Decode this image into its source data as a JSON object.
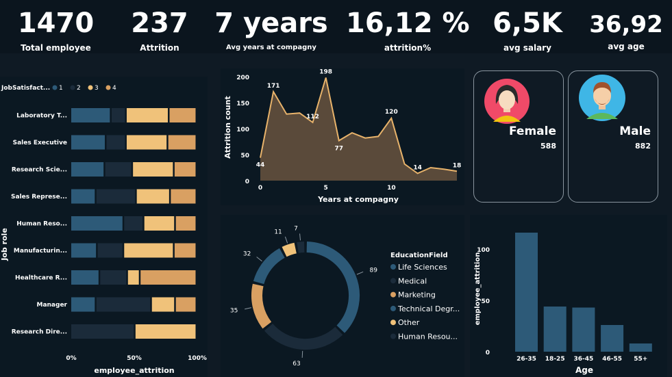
{
  "kpis": [
    {
      "value": "1470",
      "label": "Total employee"
    },
    {
      "value": "237",
      "label": "Attrition"
    },
    {
      "value": "7 years",
      "label": "Avg years at compagny"
    },
    {
      "value": "16,12 %",
      "label": "attrition%"
    },
    {
      "value": "6,5K",
      "label": "avg salary"
    },
    {
      "value": "36,92",
      "label": "avg age"
    }
  ],
  "job_chart": {
    "legend_title": "JobSatisfact...",
    "legend": [
      {
        "label": "1",
        "color": "#2d5a78"
      },
      {
        "label": "2",
        "color": "#1b2b3a"
      },
      {
        "label": "3",
        "color": "#f0c27a"
      },
      {
        "label": "4",
        "color": "#d9a062"
      }
    ],
    "y_title": "Job role",
    "x_title": "employee_attrition",
    "x_ticks": [
      "0%",
      "50%",
      "100%"
    ]
  },
  "attrition_years": {
    "y_title": "Attrition count",
    "x_title": "Years at compagny",
    "y_ticks": [
      "0",
      "50",
      "100",
      "150",
      "200"
    ],
    "x_ticks": [
      "0",
      "5",
      "10"
    ],
    "labels": [
      "44",
      "171",
      "112",
      "198",
      "77",
      "120",
      "14",
      "18"
    ]
  },
  "gender": {
    "female": {
      "label": "Female",
      "value": "588"
    },
    "male": {
      "label": "Male",
      "value": "882"
    }
  },
  "education": {
    "legend_title": "EducationField",
    "items": [
      {
        "label": "Life Sciences",
        "color": "#2d5a78"
      },
      {
        "label": "Medical",
        "color": "#1b2b3a"
      },
      {
        "label": "Marketing",
        "color": "#d9a062"
      },
      {
        "label": "Technical Degr...",
        "color": "#2d5a78"
      },
      {
        "label": "Other",
        "color": "#f0c27a"
      },
      {
        "label": "Human Resou...",
        "color": "#1b2b3a"
      }
    ]
  },
  "age_chart": {
    "y_title": "employee_attrition",
    "x_title": "Age",
    "y_ticks": [
      "0",
      "50",
      "100"
    ]
  },
  "chart_data": [
    {
      "type": "bar",
      "orientation": "horizontal-stacked-100",
      "categories": [
        "Laboratory T...",
        "Sales Executive",
        "Research Scie...",
        "Sales Represe...",
        "Human Reso...",
        "Manufacturin...",
        "Healthcare R...",
        "Manager",
        "Research Dire..."
      ],
      "series": [
        {
          "name": "1",
          "values": [
            32,
            28,
            27,
            20,
            42,
            21,
            23,
            20,
            0
          ]
        },
        {
          "name": "2",
          "values": [
            12,
            16,
            22,
            32,
            16,
            21,
            22,
            44,
            51
          ]
        },
        {
          "name": "3",
          "values": [
            34,
            33,
            33,
            27,
            25,
            40,
            10,
            19,
            49
          ]
        },
        {
          "name": "4",
          "values": [
            22,
            23,
            18,
            21,
            17,
            18,
            45,
            17,
            0
          ]
        }
      ],
      "xlabel": "employee_attrition",
      "ylabel": "Job role",
      "xlim": [
        0,
        100
      ]
    },
    {
      "type": "area",
      "x": [
        0,
        1,
        2,
        3,
        4,
        5,
        6,
        7,
        8,
        9,
        10,
        11,
        12,
        13,
        14,
        15
      ],
      "y": [
        44,
        171,
        128,
        130,
        112,
        198,
        77,
        92,
        82,
        85,
        120,
        32,
        14,
        25,
        22,
        18
      ],
      "xlabel": "Years at compagny",
      "ylabel": "Attrition count",
      "ylim": [
        0,
        200
      ],
      "data_labels": {
        "0": "44",
        "1": "171",
        "4": "112",
        "5": "198",
        "6": "77",
        "10": "120",
        "12": "14",
        "15": "18"
      }
    },
    {
      "type": "pie",
      "variant": "donut",
      "categories": [
        "Life Sciences",
        "Medical",
        "Marketing",
        "Technical Degr...",
        "Other",
        "Human Resou..."
      ],
      "values": [
        89,
        63,
        35,
        32,
        11,
        7
      ],
      "title": "EducationField"
    },
    {
      "type": "bar",
      "categories": [
        "26-35",
        "18-25",
        "36-45",
        "46-55",
        "55+"
      ],
      "values": [
        116,
        44,
        43,
        26,
        8
      ],
      "xlabel": "Age",
      "ylabel": "employee_attrition",
      "ylim": [
        0,
        120
      ]
    }
  ]
}
